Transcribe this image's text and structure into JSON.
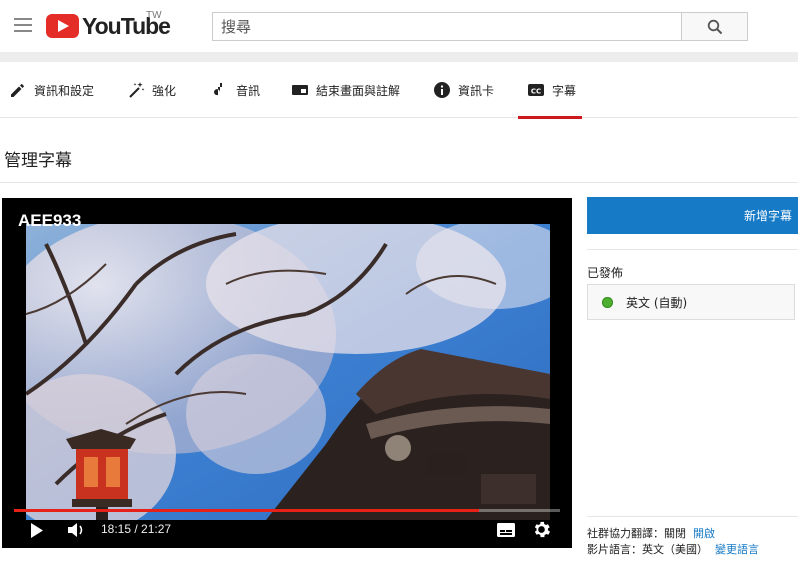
{
  "masthead": {
    "logo_text": "YouTube",
    "region": "TW",
    "search_placeholder": "搜尋"
  },
  "tabs": [
    {
      "label": "資訊和設定",
      "icon": "pencil-icon"
    },
    {
      "label": "強化",
      "icon": "magic-wand-icon"
    },
    {
      "label": "音訊",
      "icon": "music-note-icon"
    },
    {
      "label": "結束畫面與註解",
      "icon": "end-screen-icon"
    },
    {
      "label": "資訊卡",
      "icon": "info-icon"
    },
    {
      "label": "字幕",
      "icon": "cc-icon",
      "active": true
    }
  ],
  "page": {
    "title": "管理字幕"
  },
  "player": {
    "video_title": "AEE933",
    "current_time": "18:15",
    "duration": "21:27",
    "time_display": "18:15 / 21:27",
    "progress_fraction": 0.851
  },
  "panel": {
    "add_button": "新增字幕",
    "published_label": "已發佈",
    "tracks": [
      {
        "language": "英文 (自動)",
        "status": "published",
        "status_color": "#4caf30"
      }
    ],
    "community_label": "社群協力翻譯：關閉",
    "community_link": "開啟",
    "video_language_label": "影片語言：英文（美國）",
    "video_language_link": "變更語言"
  },
  "colors": {
    "brand_red": "#e52d27",
    "accent_blue": "#167ac6",
    "tab_indicator": "#cc181e",
    "progress_red": "#e62117"
  }
}
